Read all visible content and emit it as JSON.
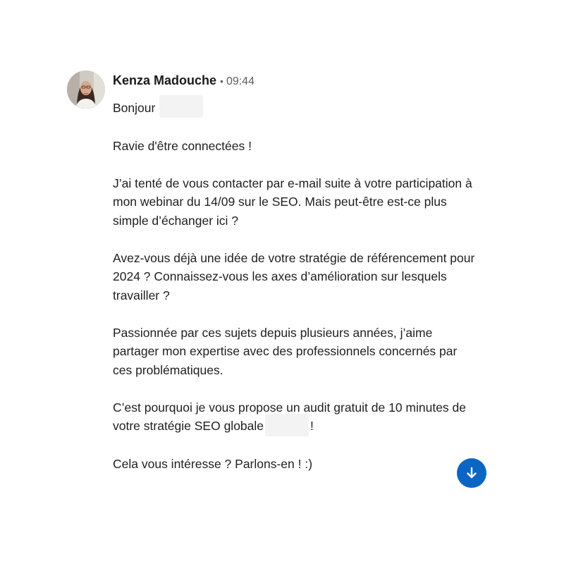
{
  "message": {
    "sender": "Kenza Madouche",
    "separator": "•",
    "time": "09:44",
    "greeting": "Bonjour",
    "paragraphs": [
      "Ravie d'être connectées !",
      "J’ai tenté de vous contacter par e-mail suite à votre participation à mon webinar du 14/09 sur le SEO. Mais peut-être est-ce plus simple d’échanger ici ?",
      "Avez-vous déjà une idée de votre stratégie de référencement pour 2024 ? Connaissez-vous les axes d’amélioration sur lesquels travailler ?",
      "Passionnée par ces sujets depuis plusieurs années, j’aime partager mon expertise avec des professionnels concernés par ces problématiques."
    ],
    "offer_text": "C’est pourquoi je vous propose un audit gratuit de 10 minutes de votre stratégie SEO globale",
    "offer_end": "!",
    "closing": "Cela vous intéresse ? Parlons-en ! :)"
  },
  "icons": {
    "avatar": "profile-photo",
    "scroll": "arrow-down-icon"
  },
  "colors": {
    "accent": "#0a66c2",
    "redaction": "#f3f3f3"
  }
}
